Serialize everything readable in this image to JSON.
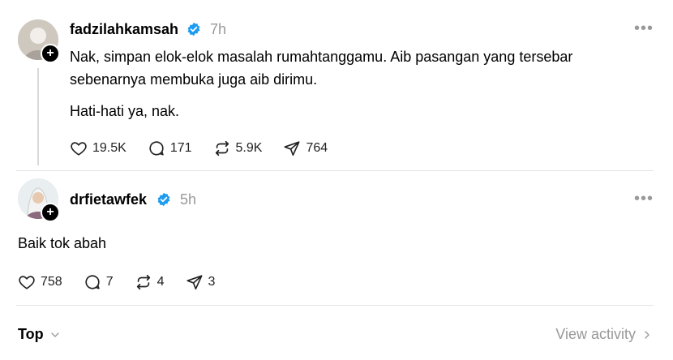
{
  "posts": [
    {
      "username": "fadzilahkamsah",
      "time": "7h",
      "paragraphs": [
        "Nak, simpan elok-elok masalah rumahtanggamu. Aib pasangan yang tersebar",
        "sebenarnya membuka juga aib dirimu.",
        "Hati-hati ya, nak."
      ],
      "likes": "19.5K",
      "replies": "171",
      "reposts": "5.9K",
      "shares": "764"
    },
    {
      "username": "drfietawfek",
      "time": "5h",
      "paragraphs": [
        "Baik tok abah"
      ],
      "likes": "758",
      "replies": "7",
      "reposts": "4",
      "shares": "3"
    }
  ],
  "more_label": "•••",
  "footer": {
    "sort_label": "Top",
    "activity_label": "View activity"
  },
  "colors": {
    "verified": "#1d9bf0",
    "muted": "#999999"
  }
}
